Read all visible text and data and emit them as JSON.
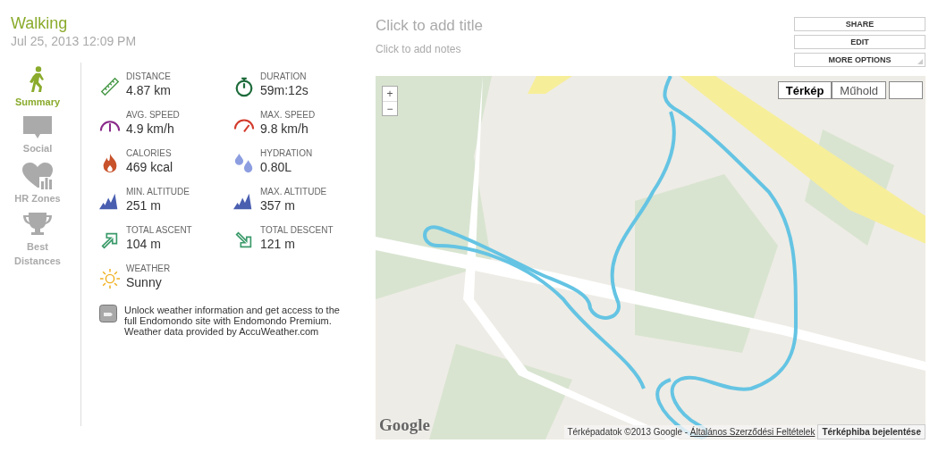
{
  "workout": {
    "sport": "Walking",
    "date": "Jul 25, 2013 12:09 PM",
    "title_placeholder": "Click to add title",
    "notes_placeholder": "Click to add notes"
  },
  "actions": [
    {
      "label": "SHARE",
      "kind": "plain"
    },
    {
      "label": "EDIT",
      "kind": "plain"
    },
    {
      "label": "MORE OPTIONS",
      "kind": "menu"
    }
  ],
  "sidebar": {
    "items": [
      {
        "label": "Summary",
        "kind": "walker",
        "selected": true
      },
      {
        "label": "Social",
        "kind": "speech",
        "selected": false
      },
      {
        "label": "HR Zones",
        "kind": "heart",
        "selected": false
      },
      {
        "label": "Best Distances",
        "kind": "trophy",
        "selected": false
      }
    ]
  },
  "stats": [
    {
      "kind": "distance",
      "label": "DISTANCE",
      "value": "4.87 km"
    },
    {
      "kind": "duration",
      "label": "DURATION",
      "value": "59m:12s"
    },
    {
      "kind": "avg_speed",
      "label": "AVG. SPEED",
      "value": "4.9 km/h"
    },
    {
      "kind": "max_speed",
      "label": "MAX. SPEED",
      "value": "9.8 km/h"
    },
    {
      "kind": "calories",
      "label": "CALORIES",
      "value": "469 kcal"
    },
    {
      "kind": "hydration",
      "label": "HYDRATION",
      "value": "0.80L"
    },
    {
      "kind": "altitude",
      "label": "MIN. ALTITUDE",
      "value": "251 m"
    },
    {
      "kind": "altitude",
      "label": "MAX. ALTITUDE",
      "value": "357 m"
    },
    {
      "kind": "ascent",
      "label": "TOTAL ASCENT",
      "value": "104 m"
    },
    {
      "kind": "descent",
      "label": "TOTAL DESCENT",
      "value": "121 m"
    },
    {
      "kind": "weather",
      "label": "WEATHER",
      "value": "Sunny"
    }
  ],
  "premium_note": [
    "Unlock weather information and get access to the full Endomondo site with Endomondo Premium.",
    "Weather data provided by AccuWeather.com"
  ],
  "map": {
    "zoom_in": "+",
    "zoom_out": "−",
    "types": [
      {
        "label": "Térkép",
        "selected": true
      },
      {
        "label": "Műhold",
        "selected": false
      }
    ],
    "logo": "Google",
    "attribution": "Térképadatok ©2013 Google - ",
    "terms_link": "Általános Szerződési Feltételek",
    "report_button": "Térképhiba bejelentése"
  }
}
